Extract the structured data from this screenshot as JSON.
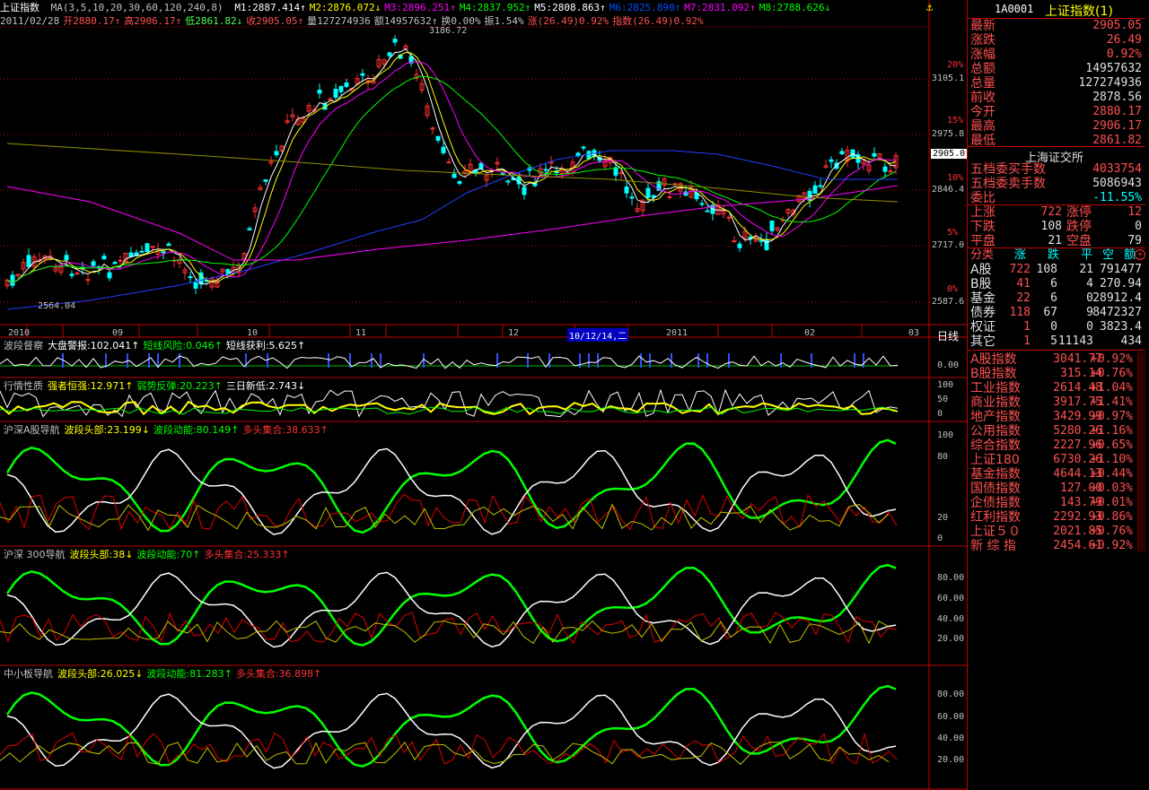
{
  "header": {
    "index_name": "上证指数",
    "ma_label": "MA(3,5,10,20,30,60,120,240,8)",
    "ma": [
      {
        "t": "M1:2887.414↑",
        "c": "#ffffff"
      },
      {
        "t": "M2:2876.072↓",
        "c": "#ffff00"
      },
      {
        "t": "M3:2896.251↑",
        "c": "#ff00ff"
      },
      {
        "t": "M4:2837.952↑",
        "c": "#00ff00"
      },
      {
        "t": "M5:2808.863↑",
        "c": "#ffffff"
      },
      {
        "t": "M6:2825.890↑",
        "c": "#0050ff"
      },
      {
        "t": "M7:2831.092↑",
        "c": "#ff00ff"
      },
      {
        "t": "M8:2788.626↓",
        "c": "#00ff00"
      }
    ],
    "line2": [
      {
        "t": "2011/02/28",
        "c": "#c0c0c0"
      },
      {
        "t": "开2880.17↑",
        "c": "#ff5050"
      },
      {
        "t": "高2906.17↑",
        "c": "#ff5050"
      },
      {
        "t": "低2861.82↓",
        "c": "#50ff50"
      },
      {
        "t": "收2905.05↑",
        "c": "#ff5050"
      },
      {
        "t": "量127274936",
        "c": "#c0c0c0"
      },
      {
        "t": "额14957632↑",
        "c": "#c0c0c0"
      },
      {
        "t": "换0.00%",
        "c": "#c0c0c0"
      },
      {
        "t": "振1.54%",
        "c": "#c0c0c0"
      },
      {
        "t": "涨(26.49)0.92%",
        "c": "#ff5050"
      },
      {
        "t": "指数(26.49)0.92%",
        "c": "#ff5050"
      }
    ],
    "peak_label": "3186.72",
    "low_label": "2564.04",
    "price_tag": "2905.0"
  },
  "price_axis": [
    {
      "v": "3105.1",
      "pct": "20%"
    },
    {
      "v": "2975.8",
      "pct": "15%"
    },
    {
      "v": "2846.4",
      "pct": "10%"
    },
    {
      "v": "2717.0",
      "pct": "5%"
    },
    {
      "v": "2587.6",
      "pct": "0%"
    }
  ],
  "date_axis": [
    "2010",
    "09",
    "10",
    "11",
    "12",
    "10/12/14,二",
    "2011",
    "02",
    "03"
  ],
  "period_label": "日线",
  "indicators": [
    {
      "title": "波段督察",
      "parts": [
        {
          "t": "大盘警报:102.041↑",
          "c": "#ffffff"
        },
        {
          "t": "短线风险:0.046↑",
          "c": "#00ff00"
        },
        {
          "t": "短线获利:5.625↑",
          "c": "#ffffff"
        }
      ],
      "axis": [
        "0.00"
      ]
    },
    {
      "title": "行情性质",
      "parts": [
        {
          "t": "强者恒强:12.971↑",
          "c": "#ffff00"
        },
        {
          "t": "弱势反弹:20.223↑",
          "c": "#00ff00"
        },
        {
          "t": "三日新低:2.743↓",
          "c": "#ffffff"
        }
      ],
      "axis": [
        "100",
        "50",
        "0"
      ]
    },
    {
      "title": "沪深A股导航",
      "parts": [
        {
          "t": "波段头部:23.199↓",
          "c": "#ffff00"
        },
        {
          "t": "波段动能:80.149↑",
          "c": "#00ff00"
        },
        {
          "t": "多头集合:38.633↑",
          "c": "#ff3030"
        }
      ],
      "axis": [
        "100",
        "80",
        "20",
        "0"
      ]
    },
    {
      "title": "沪深 300导航",
      "parts": [
        {
          "t": "波段头部:38↓",
          "c": "#ffff00"
        },
        {
          "t": "波段动能:70↑",
          "c": "#00ff00"
        },
        {
          "t": "多头集合:25.333↑",
          "c": "#ff3030"
        }
      ],
      "axis": [
        "80.00",
        "60.00",
        "40.00",
        "20.00"
      ]
    },
    {
      "title": "中小板导航",
      "parts": [
        {
          "t": "波段头部:26.025↓",
          "c": "#ffff00"
        },
        {
          "t": "波段动能:81.283↑",
          "c": "#00ff00"
        },
        {
          "t": "多头集合:36.898↑",
          "c": "#ff3030"
        }
      ],
      "axis": [
        "80.00",
        "60.00",
        "40.00",
        "20.00"
      ]
    }
  ],
  "panel": {
    "code": "1A0001",
    "name": "上证指数(1)",
    "quote": [
      {
        "l": "最新",
        "v": "2905.05",
        "c": "redv"
      },
      {
        "l": "涨跌",
        "v": "26.49",
        "c": "redv"
      },
      {
        "l": "涨幅",
        "v": "0.92%",
        "c": "redv"
      },
      {
        "l": "总额",
        "v": "14957632",
        "c": "whtv"
      },
      {
        "l": "总量",
        "v": "127274936",
        "c": "whtv"
      },
      {
        "l": "前收",
        "v": "2878.56",
        "c": "whtv"
      },
      {
        "l": "今开",
        "v": "2880.17",
        "c": "redv"
      },
      {
        "l": "最高",
        "v": "2906.17",
        "c": "redv"
      },
      {
        "l": "最低",
        "v": "2861.82",
        "c": "redv"
      }
    ],
    "exchange": "上海证交所",
    "orders": [
      {
        "l": "五档委买手数",
        "v": "4033754",
        "c": "redv"
      },
      {
        "l": "五档委卖手数",
        "v": "5086943",
        "c": "whtv"
      },
      {
        "l": "委比",
        "v": "-11.55%",
        "c": "cyan"
      }
    ],
    "breadth": [
      {
        "a": "上涨",
        "av": "722",
        "b": "涨停",
        "bv": "12",
        "ac": "redv",
        "bc": "redv"
      },
      {
        "a": "下跌",
        "av": "108",
        "b": "跌停",
        "bv": "0",
        "ac": "whtv",
        "bc": "whtv"
      },
      {
        "a": "平盘",
        "av": "21",
        "b": "空盘",
        "bv": "79",
        "ac": "whtv",
        "bc": "whtv"
      }
    ],
    "cat_header": [
      "分类",
      "涨",
      "跌",
      "平",
      "空",
      "额"
    ],
    "cats": [
      {
        "n": "A股",
        "u": "722",
        "d": "108",
        "f": "21",
        "e": "791477"
      },
      {
        "n": "B股",
        "u": "41",
        "d": "6",
        "f": "4",
        "e": "270.94"
      },
      {
        "n": "基金",
        "u": "22",
        "d": "6",
        "f": "0",
        "e": "28912.4"
      },
      {
        "n": "债券",
        "u": "118",
        "d": "67",
        "f": "9",
        "e": "8472327"
      },
      {
        "n": "权证",
        "u": "1",
        "d": "0",
        "f": "0",
        "e": "3823.4"
      },
      {
        "n": "其它",
        "u": "1",
        "d": "5",
        "f": "11143",
        "e": "434"
      }
    ],
    "indices": [
      {
        "n": "A股指数",
        "v": "3041.77",
        "p": "+0.92%"
      },
      {
        "n": "B股指数",
        "v": "315.14",
        "p": "+0.76%"
      },
      {
        "n": "工业指数",
        "v": "2614.48",
        "p": "+1.04%"
      },
      {
        "n": "商业指数",
        "v": "3917.75",
        "p": "+1.41%"
      },
      {
        "n": "地产指数",
        "v": "3429.99",
        "p": "+0.97%"
      },
      {
        "n": "公用指数",
        "v": "5280.26",
        "p": "+1.16%"
      },
      {
        "n": "综合指数",
        "v": "2227.96",
        "p": "+0.65%"
      },
      {
        "n": "上证180",
        "v": "6730.26",
        "p": "+1.10%"
      },
      {
        "n": "基金指数",
        "v": "4644.13",
        "p": "+0.44%"
      },
      {
        "n": "国债指数",
        "v": "127.00",
        "p": "+0.03%"
      },
      {
        "n": "企债指数",
        "v": "143.79",
        "p": "+0.01%"
      },
      {
        "n": "红利指数",
        "v": "2292.93",
        "p": "+0.86%"
      },
      {
        "n": "上证５０",
        "v": "2021.85",
        "p": "+0.76%"
      },
      {
        "n": "新 综 指",
        "v": "2454.61",
        "p": "+0.92%"
      }
    ]
  }
}
